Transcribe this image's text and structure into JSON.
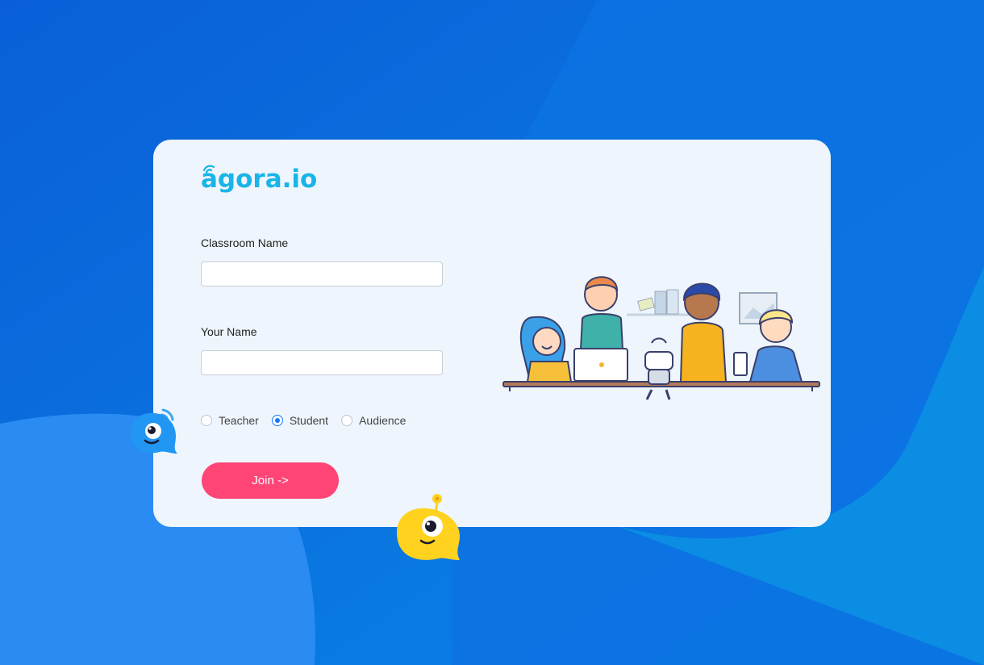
{
  "logo": {
    "text": "agora.io"
  },
  "form": {
    "classroom_label": "Classroom Name",
    "classroom_value": "",
    "name_label": "Your Name",
    "name_value": ""
  },
  "roles": {
    "options": [
      "Teacher",
      "Student",
      "Audience"
    ],
    "selected": "Student"
  },
  "join_label": "Join ->",
  "colors": {
    "accent_button": "#ff4576",
    "radio_checked": "#1677ff",
    "logo": "#1ab4e8",
    "card_bg": "#eef5fc",
    "background": "#0a6fe0"
  },
  "icons": [
    "blue-mascot-icon",
    "yellow-mascot-icon",
    "wifi-icon",
    "classroom-illustration"
  ]
}
